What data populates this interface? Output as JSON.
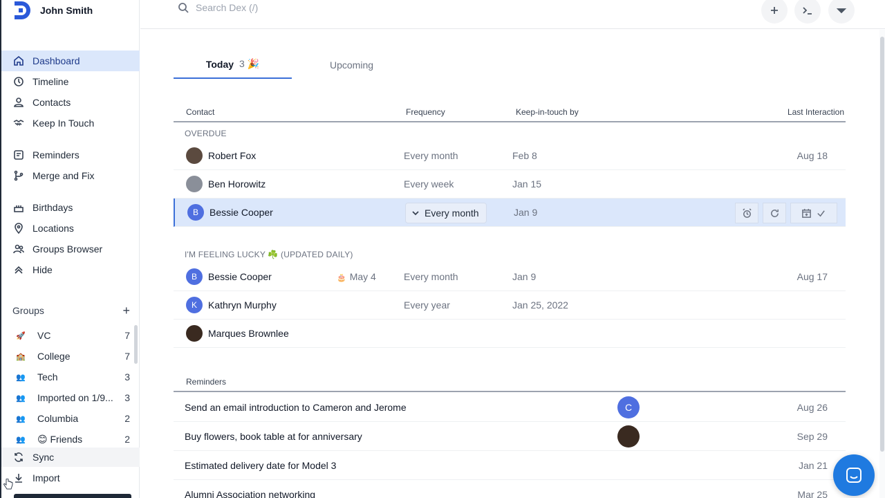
{
  "user": {
    "name": "John Smith"
  },
  "nav": [
    {
      "label": "Dashboard",
      "icon": "home-icon",
      "active": true
    },
    {
      "label": "Timeline",
      "icon": "clock-icon"
    },
    {
      "label": "Contacts",
      "icon": "user-icon"
    },
    {
      "label": "Keep In Touch",
      "icon": "handshake-icon"
    },
    {
      "label": "Reminders",
      "icon": "reminder-icon"
    },
    {
      "label": "Merge and Fix",
      "icon": "merge-icon"
    },
    {
      "label": "Birthdays",
      "icon": "birthday-icon"
    },
    {
      "label": "Locations",
      "icon": "location-icon"
    },
    {
      "label": "Groups Browser",
      "icon": "groups-icon"
    },
    {
      "label": "Hide",
      "icon": "hide-icon"
    }
  ],
  "groups": {
    "title": "Groups",
    "items": [
      {
        "emoji": "🚀",
        "name": "VC",
        "count": "7"
      },
      {
        "emoji": "🏫",
        "name": "College",
        "count": "7"
      },
      {
        "emoji": "👥",
        "name": "Tech",
        "count": "3"
      },
      {
        "emoji": "👥",
        "name": "Imported on 1/9...",
        "count": "3"
      },
      {
        "emoji": "👥",
        "name": "Columbia",
        "count": "2"
      },
      {
        "emoji": "👥",
        "name": "😊 Friends",
        "count": "2"
      }
    ]
  },
  "bottom_nav": [
    {
      "label": "Sync"
    },
    {
      "label": "Import"
    }
  ],
  "search": {
    "placeholder": "Search Dex (/)"
  },
  "tabs": [
    {
      "label": "Today",
      "badge": "3 🎉",
      "active": true
    },
    {
      "label": "Upcoming"
    }
  ],
  "table": {
    "headers": {
      "contact": "Contact",
      "frequency": "Frequency",
      "keep": "Keep-in-touch by",
      "last": "Last Interaction"
    },
    "overdue_label": "OVERDUE",
    "overdue": [
      {
        "name": "Robert Fox",
        "frequency": "Every month",
        "keep_by": "Feb 8",
        "last": "Aug 18",
        "avatar_color": "#5b4a3f"
      },
      {
        "name": "Ben Horowitz",
        "frequency": "Every week",
        "keep_by": "Jan 15",
        "last": "",
        "avatar_color": "#8a8f99"
      },
      {
        "name": "Bessie Cooper",
        "initial": "B",
        "frequency": "Every month",
        "keep_by": "Jan 9",
        "last": "",
        "avatar_color": "#4f6fe0",
        "selected": true
      }
    ],
    "lucky_label": "I'M FEELING LUCKY ☘️ (UPDATED DAILY)",
    "lucky": [
      {
        "name": "Bessie Cooper",
        "initial": "B",
        "birthday": "May 4",
        "frequency": "Every month",
        "keep_by": "Jan 9",
        "last": "Aug 17",
        "avatar_color": "#4f6fe0"
      },
      {
        "name": "Kathryn Murphy",
        "initial": "K",
        "frequency": "Every year",
        "keep_by": "Jan 25, 2022",
        "last": "",
        "avatar_color": "#4f6fe0"
      },
      {
        "name": "Marques Brownlee",
        "frequency": "",
        "keep_by": "",
        "last": "",
        "avatar_color": "#3a2a20"
      }
    ]
  },
  "reminders": {
    "title": "Reminders",
    "items": [
      {
        "text": "Send an email introduction to Cameron and Jerome",
        "avatar": "C",
        "avatar_color": "#4f6fe0",
        "date": "Aug 26"
      },
      {
        "text": "Buy flowers, book table at for anniversary",
        "avatar": "",
        "avatar_color": "#3a2a20",
        "date": "Sep 29"
      },
      {
        "text": "Estimated delivery date for Model 3",
        "avatar": "",
        "date": "Jan 21"
      },
      {
        "text": "Alumni Association networking",
        "avatar": "",
        "date": "Mar 25"
      }
    ]
  }
}
